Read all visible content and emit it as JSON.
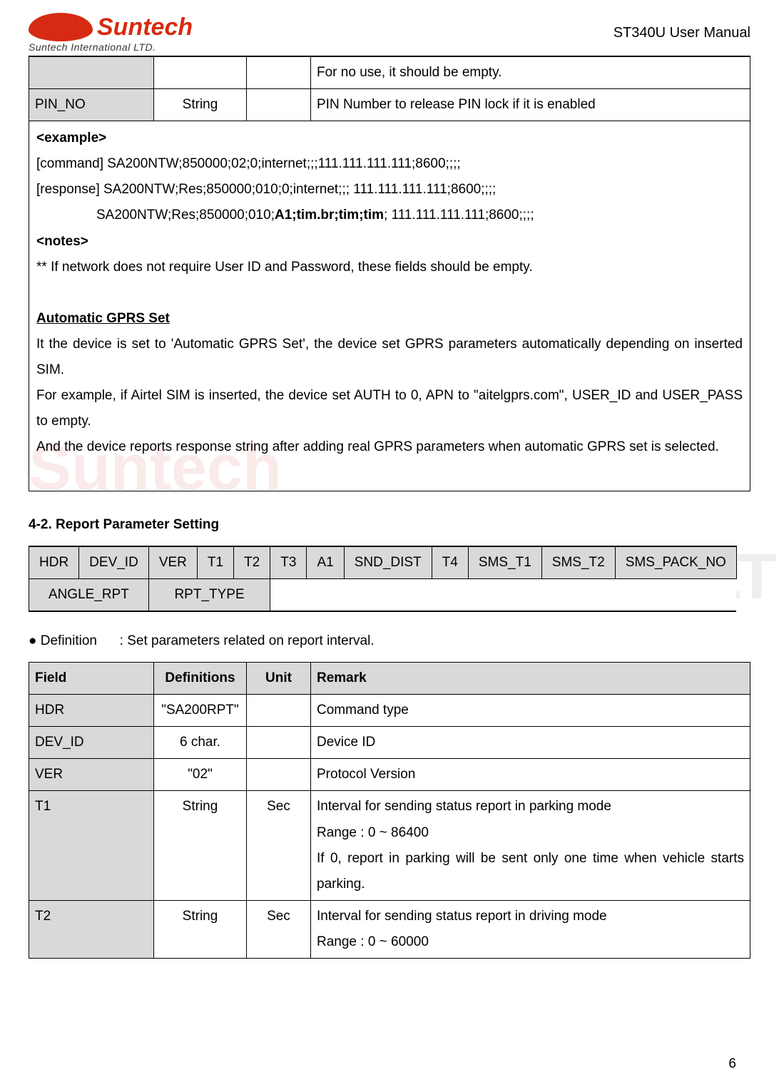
{
  "logo": {
    "brand": "Suntech",
    "subtitle": "Suntech International LTD."
  },
  "doc_title": "ST340U User Manual",
  "table1_rows": [
    {
      "field": "",
      "def": "",
      "unit": "",
      "remark": "For no use, it should be empty."
    },
    {
      "field": "PIN_NO",
      "def": "String",
      "unit": "",
      "remark": "PIN Number to release PIN lock if it is enabled"
    }
  ],
  "example": {
    "title": "<example>",
    "line1_prefix": "[command] SA200NTW;850000;02;0;internet;;;111.111.111.111;8600;;;;",
    "line2": "[response] SA200NTW;Res;850000;010;0;internet;;; 111.111.111.111;8600;;;;",
    "line3_prefix": "SA200NTW;Res;850000;010;",
    "line3_bold": "A1;tim.br;tim;tim",
    "line3_suffix": "; 111.111.111.111;8600;;;;",
    "notes_title": "<notes>",
    "notes_body": "** If network does not require User ID and Password, these fields should be empty.",
    "auto_title": "Automatic GPRS Set",
    "auto_p1": "It the device is set to 'Automatic GPRS Set', the device set GPRS parameters automatically depending on inserted SIM.",
    "auto_p2": "For example, if Airtel SIM is inserted, the device set AUTH to 0, APN to \"aitelgprs.com\", USER_ID and USER_PASS to empty.",
    "auto_p3": "And the device reports response string after adding real GPRS parameters when automatic GPRS set is selected."
  },
  "section_4_2": "4-2. Report Parameter Setting",
  "struct_row1": [
    "HDR",
    "DEV_ID",
    "VER",
    "T1",
    "T2",
    "T3",
    "A1",
    "SND_DIST",
    "T4",
    "SMS_T1",
    "SMS_T2",
    "SMS_PACK_NO"
  ],
  "struct_row2": [
    "ANGLE_RPT",
    "RPT_TYPE"
  ],
  "definition_line_label": "● Definition",
  "definition_line_text": ": Set parameters related on report interval.",
  "def_headers": {
    "field": "Field",
    "def": "Definitions",
    "unit": "Unit",
    "remark": "Remark"
  },
  "def_rows": [
    {
      "field": "HDR",
      "def": "\"SA200RPT\"",
      "unit": "",
      "remark": "Command type"
    },
    {
      "field": "DEV_ID",
      "def": "6 char.",
      "unit": "",
      "remark": "Device ID"
    },
    {
      "field": "VER",
      "def": "\"02\"",
      "unit": "",
      "remark": "Protocol Version"
    },
    {
      "field": "T1",
      "def": "String",
      "unit": "Sec",
      "remark": "Interval for sending status report in parking mode\nRange : 0 ~ 86400\nIf 0, report in parking will be sent only one time when vehicle starts parking."
    },
    {
      "field": "T2",
      "def": "String",
      "unit": "Sec",
      "remark": "Interval for sending status report in driving mode\nRange : 0 ~ 60000"
    }
  ],
  "page_number": "6",
  "watermark_line1": "Suntech",
  "watermark_line2": "Suntech International LTD."
}
